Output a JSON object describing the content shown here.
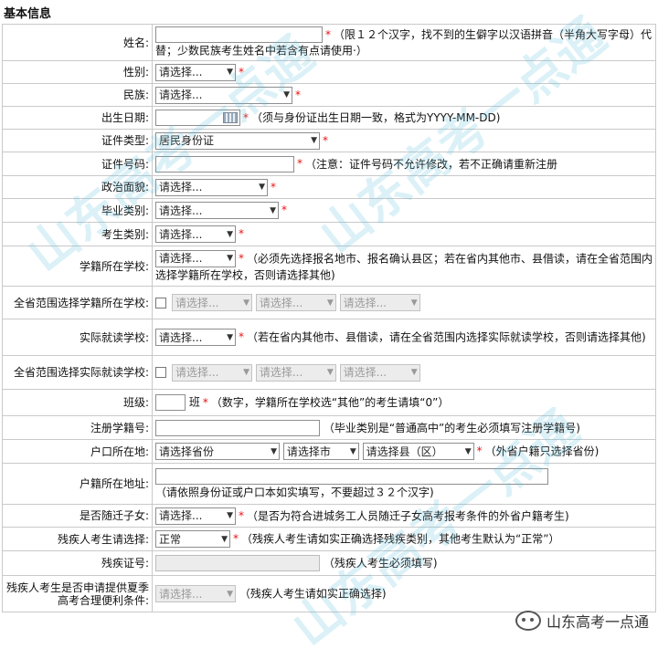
{
  "section_title": "基本信息",
  "placeholder": "请选择...",
  "fields": {
    "name": {
      "label": "姓名:",
      "note": "（限１２个汉字，找不到的生僻字以汉语拼音（半角大写字母）代替；少数民族考生姓名中若含有点请使用·）"
    },
    "gender": {
      "label": "性别:"
    },
    "ethnicity": {
      "label": "民族:"
    },
    "birthdate": {
      "label": "出生日期:",
      "note": "（须与身份证出生日期一致，格式为YYYY-MM-DD)"
    },
    "id_type": {
      "label": "证件类型:",
      "value": "居民身份证"
    },
    "id_number": {
      "label": "证件号码:",
      "note": "（注意：证件号码不允许修改，若不正确请重新注册"
    },
    "political": {
      "label": "政治面貌:"
    },
    "grad_type": {
      "label": "毕业类别:"
    },
    "exam_type": {
      "label": "考生类别:"
    },
    "school": {
      "label": "学籍所在学校:",
      "note": "（必须先选择报名地市、报名确认县区；若在省内其他市、县借读，请在全省范围内选择学籍所在学校，否则请选择其他)"
    },
    "prov_school": {
      "label": "全省范围选择学籍所在学校:"
    },
    "actual_school": {
      "label": "实际就读学校:",
      "note": "（若在省内其他市、县借读，请在全省范围内选择实际就读学校，否则请选择其他)"
    },
    "prov_actual": {
      "label": "全省范围选择实际就读学校:"
    },
    "class": {
      "label": "班级:",
      "suffix": "班",
      "note": "（数字，学籍所在学校选“其他”的考生请填“0”）"
    },
    "reg_number": {
      "label": "注册学籍号:",
      "note": "（毕业类别是“普通高中”的考生必须填写注册学籍号)"
    },
    "hukou": {
      "label": "户口所在地:",
      "province": "请选择省份",
      "city": "请选择市",
      "county": "请选择县（区）",
      "note": "（外省户籍只选择省份)"
    },
    "hukou_address": {
      "label": "户籍所在地址:",
      "note": "（请依照身份证或户口本如实填写，不要超过３２个汉字)"
    },
    "migrant": {
      "label": "是否随迁子女:",
      "note": "（是否为符合进城务工人员随迁子女高考报考条件的外省户籍考生)"
    },
    "disability": {
      "label": "残疾人考生请选择:",
      "value": "正常",
      "note": "（残疾人考生请如实正确选择残疾类别，其他考生默认为“正常”）"
    },
    "disability_cert": {
      "label": "残疾证号:",
      "note": "（残疾人考生必须填写)"
    },
    "disability_request": {
      "label": "残疾人考生是否申请提供夏季高考合理便利条件:",
      "note": "（残疾人考生请如实正确选择)"
    }
  },
  "watermarks": [
    "山东高考一点通",
    "山东高考一点通",
    "山东高考一点通"
  ],
  "logo_text": "山东高考一点通",
  "colors": {
    "required_star": "#e11111",
    "border": "#c9c9c9",
    "watermark": "#5abedc"
  }
}
